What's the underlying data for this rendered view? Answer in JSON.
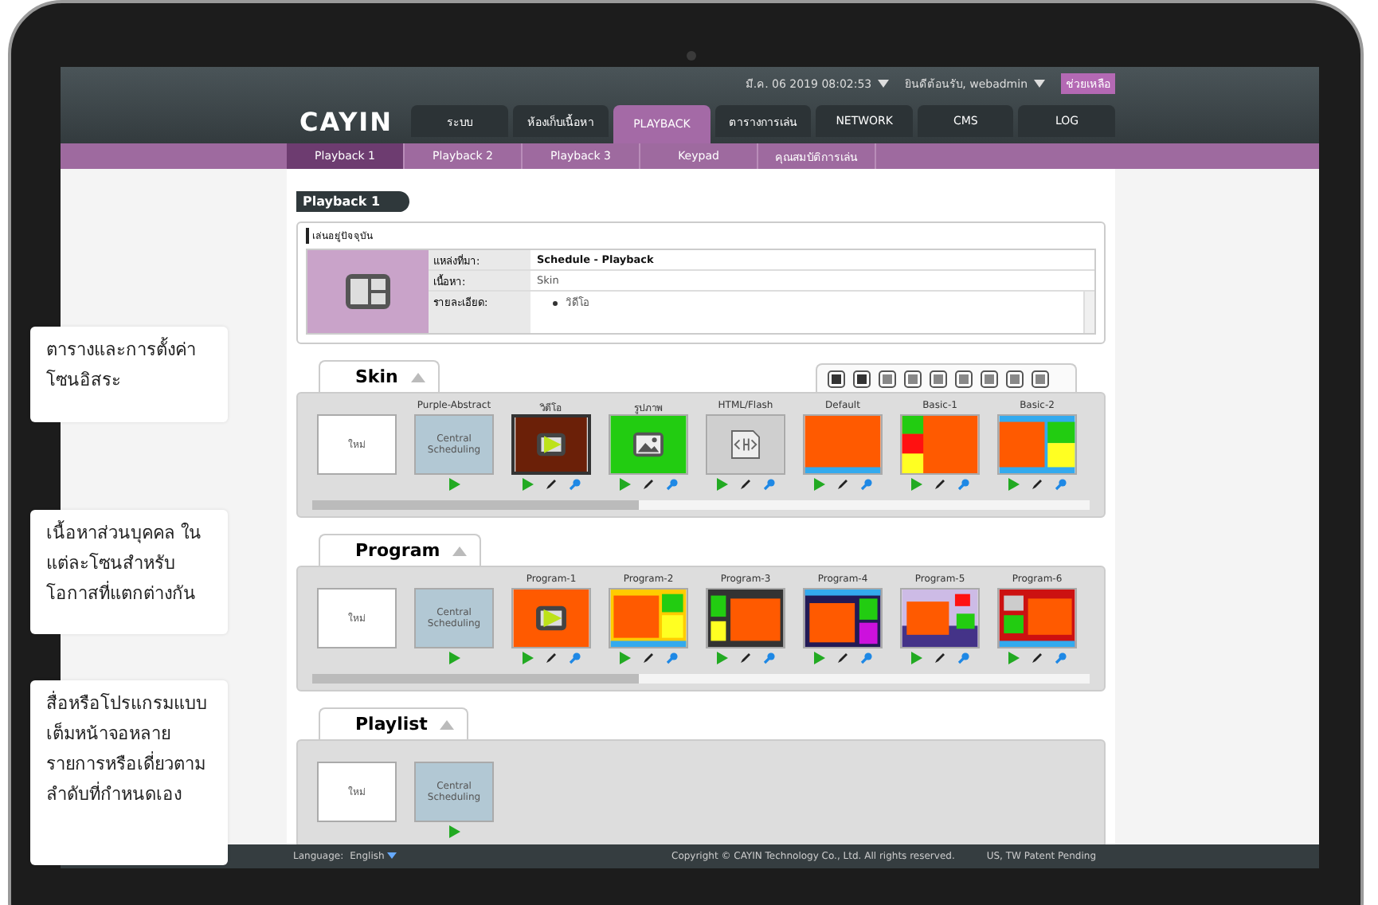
{
  "header": {
    "logo": "CAYIN",
    "datetime": "มี.ค. 06 2019 08:02:53",
    "user": "ยินดีต้อนรับ, webadmin",
    "help": "ช่วยเหลือ"
  },
  "nav": [
    {
      "label": "ระบบ",
      "selected": false
    },
    {
      "label": "ห้องเก็บเนื้อหา",
      "selected": false
    },
    {
      "label": "PLAYBACK",
      "selected": true
    },
    {
      "label": "ตารางการเล่น",
      "selected": false
    },
    {
      "label": "NETWORK",
      "selected": false
    },
    {
      "label": "CMS",
      "selected": false
    },
    {
      "label": "LOG",
      "selected": false
    }
  ],
  "subnav": [
    {
      "label": "Playback 1",
      "selected": true
    },
    {
      "label": "Playback 2",
      "selected": false
    },
    {
      "label": "Playback 3",
      "selected": false
    },
    {
      "label": "Keypad",
      "selected": false
    },
    {
      "label": "คุณสมบัติการเล่น",
      "selected": false
    }
  ],
  "page_title": "Playback 1",
  "current": {
    "title": "เล่นอยู่ปัจจุบัน",
    "rows": [
      {
        "label": "แหล่งที่มา:",
        "value": "Schedule - Playback",
        "emphasis": true
      },
      {
        "label": "เนื้อหา:",
        "value": "Skin",
        "emphasis": false
      }
    ],
    "details_label": "รายละเอียด:",
    "details": [
      "วิดีโอ"
    ]
  },
  "sections": [
    {
      "title": "Skin",
      "expanded": true,
      "has_tools": true,
      "scrollbar": true,
      "items": [
        {
          "kind": "new",
          "caption": "ใหม่",
          "selected": false
        },
        {
          "kind": "central",
          "label": "Purple-Abstract",
          "caption": "Central Scheduling",
          "selected": false
        },
        {
          "kind": "video",
          "label": "วิดีโอ",
          "selected": true
        },
        {
          "kind": "image",
          "label": "รูปภาพ",
          "selected": false
        },
        {
          "kind": "html",
          "label": "HTML/Flash",
          "selected": false
        },
        {
          "kind": "single",
          "label": "Default",
          "selected": false
        },
        {
          "kind": "basic1",
          "label": "Basic-1",
          "selected": false
        },
        {
          "kind": "basic2",
          "label": "Basic-2",
          "selected": false
        }
      ]
    },
    {
      "title": "Program",
      "expanded": true,
      "has_tools": false,
      "scrollbar": true,
      "items": [
        {
          "kind": "new",
          "caption": "ใหม่",
          "selected": false
        },
        {
          "kind": "central",
          "caption": "Central Scheduling",
          "selected": false
        },
        {
          "kind": "prog1",
          "label": "Program-1",
          "selected": false
        },
        {
          "kind": "prog2",
          "label": "Program-2",
          "selected": false
        },
        {
          "kind": "prog3",
          "label": "Program-3",
          "selected": false
        },
        {
          "kind": "prog4",
          "label": "Program-4",
          "selected": false
        },
        {
          "kind": "prog5",
          "label": "Program-5",
          "selected": false
        },
        {
          "kind": "prog6",
          "label": "Program-6",
          "selected": false
        }
      ]
    },
    {
      "title": "Playlist",
      "expanded": true,
      "has_tools": false,
      "scrollbar": false,
      "items": [
        {
          "kind": "new",
          "caption": "ใหม่",
          "selected": false
        },
        {
          "kind": "central",
          "caption": "Central Scheduling",
          "selected": false
        }
      ]
    }
  ],
  "callouts": [
    "ตารางและการตั้งค่าโซนอิสระ",
    "เนื้อหาส่วนบุคคล ในแต่ละโซนสำหรับโอกาสที่แตกต่างกัน",
    "สื่อหรือโปรแกรมแบบเต็มหน้าจอหลายรายการหรือเดี่ยวตามลำดับที่กำหนดเอง"
  ],
  "footer": {
    "language_label": "Language:",
    "language": "English",
    "copyright": "Copyright © CAYIN Technology Co., Ltd. All rights reserved.",
    "patent": "US, TW Patent Pending"
  }
}
